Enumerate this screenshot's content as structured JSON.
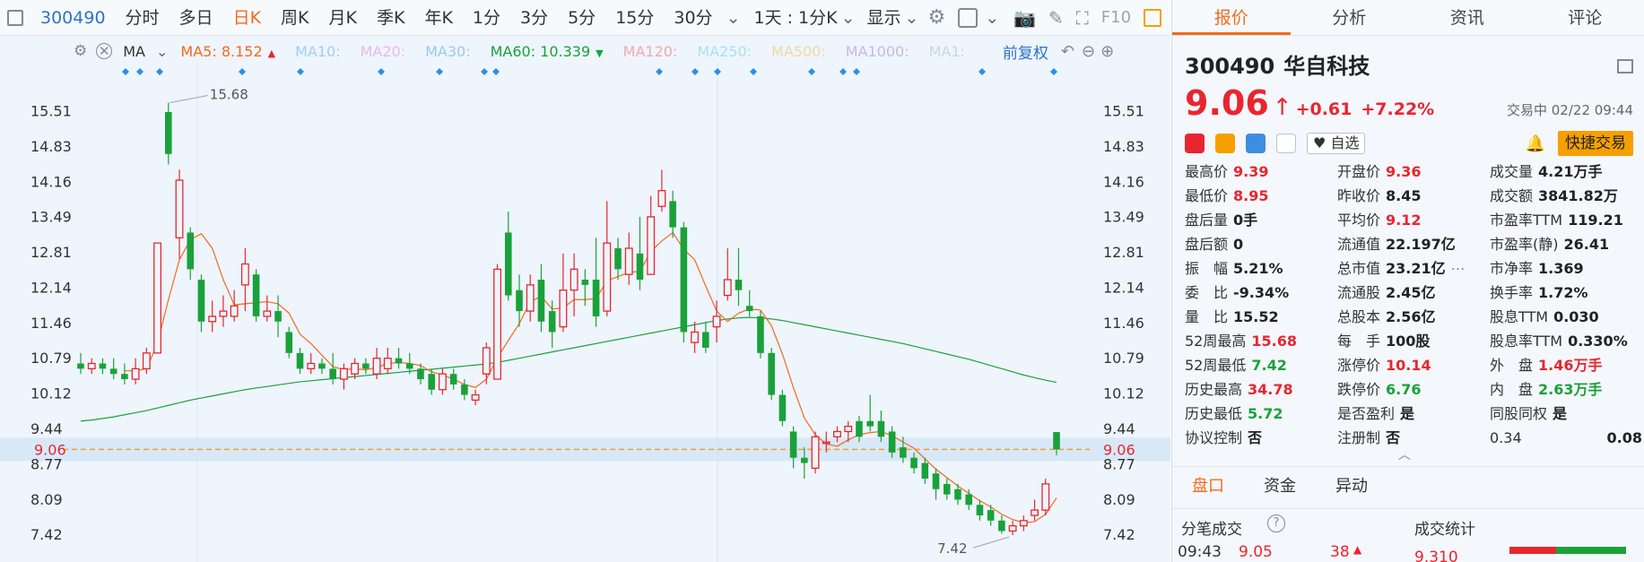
{
  "toolbar": {
    "code": "300490",
    "items": [
      "分时",
      "多日",
      "日K",
      "周K",
      "月K",
      "季K",
      "年K",
      "1分",
      "3分",
      "5分",
      "15分",
      "30分"
    ],
    "active": "日K",
    "interval": "1天 : 1分K",
    "display": "显示",
    "f10": "F10"
  },
  "ma_bar": {
    "label": "MA",
    "items": [
      {
        "text": "MA5: 8.152",
        "color": "#f5691b",
        "marker": "▲"
      },
      {
        "text": "MA10:",
        "color": "#9fd0ef",
        "marker": ""
      },
      {
        "text": "MA20:",
        "color": "#e9b9e6",
        "marker": ""
      },
      {
        "text": "MA30:",
        "color": "#9cc9ef",
        "marker": ""
      },
      {
        "text": "MA60: 10.339",
        "color": "#1aa13a",
        "marker": "▼"
      },
      {
        "text": "MA120:",
        "color": "#f2a8b0",
        "marker": ""
      },
      {
        "text": "MA250:",
        "color": "#a6e3ef",
        "marker": ""
      },
      {
        "text": "MA500:",
        "color": "#f0d9a3",
        "marker": ""
      },
      {
        "text": "MA1000:",
        "color": "#c8b8e8",
        "marker": ""
      },
      {
        "text": "MA1:",
        "color": "#c7d6e8",
        "marker": ""
      }
    ],
    "restore": "前复权"
  },
  "right_tabs": [
    "报价",
    "分析",
    "资讯",
    "评论"
  ],
  "stock": {
    "code": "300490",
    "name": "华自科技",
    "price": "9.06",
    "change": "+0.61",
    "change_pct": "+7.22%",
    "status": "交易中 02/22 09:44",
    "watch_label": "自选",
    "quick_trade": "快捷交易"
  },
  "quote_rows": [
    [
      {
        "label": "最高价",
        "value": "9.39",
        "cls": "red"
      },
      {
        "label": "开盘价",
        "value": "9.36",
        "cls": "red"
      },
      {
        "label": "成交量",
        "value": "4.21万手",
        "cls": "dark"
      }
    ],
    [
      {
        "label": "最低价",
        "value": "8.95",
        "cls": "red"
      },
      {
        "label": "昨收价",
        "value": "8.45",
        "cls": "dark"
      },
      {
        "label": "成交额",
        "value": "3841.82万",
        "cls": "dark"
      }
    ],
    [
      {
        "label": "盘后量",
        "value": "0手",
        "cls": "dark"
      },
      {
        "label": "平均价",
        "value": "9.12",
        "cls": "red"
      },
      {
        "label": "市盈率TTM",
        "value": "119.21",
        "cls": "dark"
      }
    ],
    [
      {
        "label": "盘后额",
        "value": "0",
        "cls": "dark"
      },
      {
        "label": "流通值",
        "value": "22.197亿",
        "cls": "dark"
      },
      {
        "label": "市盈率(静)",
        "value": "26.41",
        "cls": "dark"
      }
    ],
    [
      {
        "label": "振　幅",
        "value": "5.21%",
        "cls": "dark"
      },
      {
        "label": "总市值",
        "value": "23.21亿",
        "cls": "dark"
      },
      {
        "label": "市净率",
        "value": "1.369",
        "cls": "dark"
      }
    ],
    [
      {
        "label": "委　比",
        "value": "-9.34%",
        "cls": "dark"
      },
      {
        "label": "流通股",
        "value": "2.45亿",
        "cls": "dark"
      },
      {
        "label": "换手率",
        "value": "1.72%",
        "cls": "dark"
      }
    ],
    [
      {
        "label": "量　比",
        "value": "15.52",
        "cls": "dark"
      },
      {
        "label": "总股本",
        "value": "2.56亿",
        "cls": "dark"
      },
      {
        "label": "股息TTM",
        "value": "0.030",
        "cls": "dark"
      }
    ],
    [
      {
        "label": "52周最高",
        "value": "15.68",
        "cls": "red"
      },
      {
        "label": "每　手",
        "value": "100股",
        "cls": "dark"
      },
      {
        "label": "股息率TTM",
        "value": "0.330%",
        "cls": "dark"
      }
    ],
    [
      {
        "label": "52周最低",
        "value": "7.42",
        "cls": "green"
      },
      {
        "label": "涨停价",
        "value": "10.14",
        "cls": "red"
      },
      {
        "label": "外　盘",
        "value": "1.46万手",
        "cls": "red"
      }
    ],
    [
      {
        "label": "历史最高",
        "value": "34.78",
        "cls": "red"
      },
      {
        "label": "跌停价",
        "value": "6.76",
        "cls": "green"
      },
      {
        "label": "内　盘",
        "value": "2.63万手",
        "cls": "green"
      }
    ],
    [
      {
        "label": "历史最低",
        "value": "5.72",
        "cls": "green"
      },
      {
        "label": "是否盈利",
        "value": "是",
        "cls": "dark"
      },
      {
        "label": "同股同权",
        "value": "是",
        "cls": "dark"
      }
    ],
    [
      {
        "label": "协议控制",
        "value": "否",
        "cls": "dark"
      },
      {
        "label": "注册制",
        "value": "否",
        "cls": "dark"
      },
      {
        "label": "0.34",
        "value": "0.08",
        "cls": "dark"
      }
    ]
  ],
  "sub_tabs": [
    "盘口",
    "资金",
    "异动"
  ],
  "bottom": {
    "left_title": "分笔成交",
    "right_title": "成交统计",
    "tick_time": "09:43",
    "tick_price": "9.05",
    "tick_vol": "38",
    "stat_value": "9.310"
  },
  "chart_data": {
    "type": "candlestick",
    "y_ticks": [
      15.51,
      14.83,
      14.16,
      13.49,
      12.81,
      12.14,
      11.46,
      10.79,
      10.12,
      9.44,
      8.77,
      8.09,
      7.42
    ],
    "ylim": [
      7.2,
      16.1
    ],
    "current_price": 9.06,
    "high_label": "15.68",
    "low_label": "7.42",
    "up_color": "#e8262f",
    "down_color": "#1aa13a",
    "candles": [
      [
        10.7,
        10.6,
        10.9,
        10.5
      ],
      [
        10.6,
        10.7,
        10.8,
        10.5
      ],
      [
        10.7,
        10.6,
        10.8,
        10.5
      ],
      [
        10.6,
        10.5,
        10.8,
        10.4
      ],
      [
        10.5,
        10.4,
        10.7,
        10.3
      ],
      [
        10.4,
        10.6,
        10.8,
        10.3
      ],
      [
        10.6,
        10.9,
        11.0,
        10.5
      ],
      [
        10.9,
        13.0,
        13.0,
        10.9
      ],
      [
        15.5,
        14.7,
        15.68,
        14.5
      ],
      [
        13.1,
        14.2,
        14.4,
        12.7
      ],
      [
        13.2,
        12.5,
        13.3,
        12.3
      ],
      [
        12.3,
        11.5,
        12.4,
        11.3
      ],
      [
        11.5,
        11.6,
        11.9,
        11.3
      ],
      [
        11.6,
        11.7,
        12.0,
        11.4
      ],
      [
        11.6,
        11.8,
        12.1,
        11.5
      ],
      [
        12.2,
        12.6,
        12.9,
        11.7
      ],
      [
        12.4,
        11.6,
        12.5,
        11.5
      ],
      [
        11.6,
        11.7,
        12.0,
        11.5
      ],
      [
        11.7,
        11.5,
        12.0,
        11.2
      ],
      [
        11.3,
        10.9,
        11.4,
        10.8
      ],
      [
        10.9,
        10.6,
        11.0,
        10.5
      ],
      [
        10.6,
        10.7,
        10.9,
        10.5
      ],
      [
        10.7,
        10.6,
        10.8,
        10.5
      ],
      [
        10.6,
        10.4,
        10.9,
        10.3
      ],
      [
        10.4,
        10.6,
        10.7,
        10.2
      ],
      [
        10.5,
        10.7,
        10.8,
        10.4
      ],
      [
        10.7,
        10.6,
        10.8,
        10.5
      ],
      [
        10.5,
        10.8,
        11.0,
        10.4
      ],
      [
        10.6,
        10.8,
        11.0,
        10.5
      ],
      [
        10.8,
        10.7,
        11.0,
        10.6
      ],
      [
        10.7,
        10.6,
        10.9,
        10.5
      ],
      [
        10.6,
        10.4,
        10.7,
        10.3
      ],
      [
        10.5,
        10.2,
        10.6,
        10.1
      ],
      [
        10.2,
        10.5,
        10.6,
        10.1
      ],
      [
        10.5,
        10.3,
        10.6,
        10.2
      ],
      [
        10.3,
        10.1,
        10.4,
        10.0
      ],
      [
        10.0,
        10.1,
        10.2,
        9.9
      ],
      [
        10.5,
        11.0,
        11.1,
        10.3
      ],
      [
        10.4,
        12.5,
        12.6,
        10.4
      ],
      [
        13.2,
        12.0,
        13.6,
        11.9
      ],
      [
        12.1,
        11.7,
        12.4,
        11.4
      ],
      [
        11.7,
        12.2,
        12.4,
        11.5
      ],
      [
        12.3,
        11.5,
        12.6,
        11.3
      ],
      [
        11.7,
        11.3,
        11.9,
        11.0
      ],
      [
        11.4,
        12.1,
        12.8,
        11.3
      ],
      [
        12.1,
        12.5,
        12.8,
        11.6
      ],
      [
        12.3,
        12.2,
        12.5,
        11.8
      ],
      [
        12.3,
        11.6,
        13.1,
        11.4
      ],
      [
        11.7,
        13.0,
        13.8,
        11.6
      ],
      [
        12.9,
        12.5,
        13.1,
        12.3
      ],
      [
        12.4,
        12.9,
        13.2,
        12.2
      ],
      [
        12.8,
        12.3,
        13.5,
        12.1
      ],
      [
        12.4,
        13.5,
        13.9,
        12.4
      ],
      [
        13.7,
        14.0,
        14.4,
        13.6
      ],
      [
        13.8,
        13.3,
        14.0,
        13.1
      ],
      [
        13.3,
        11.3,
        13.4,
        11.1
      ],
      [
        11.1,
        11.3,
        11.5,
        10.9
      ],
      [
        11.3,
        11.0,
        11.5,
        10.9
      ],
      [
        11.4,
        11.6,
        11.9,
        11.1
      ],
      [
        12.0,
        12.3,
        12.9,
        11.9
      ],
      [
        12.3,
        12.1,
        12.9,
        11.8
      ],
      [
        11.8,
        11.7,
        12.1,
        11.6
      ],
      [
        11.6,
        10.9,
        11.7,
        10.8
      ],
      [
        10.9,
        10.1,
        11.0,
        10.0
      ],
      [
        10.1,
        9.6,
        10.2,
        9.5
      ],
      [
        9.4,
        8.9,
        9.5,
        8.7
      ],
      [
        8.9,
        8.8,
        9.1,
        8.5
      ],
      [
        8.7,
        9.3,
        9.4,
        8.6
      ],
      [
        9.2,
        9.2,
        9.4,
        9.0
      ],
      [
        9.3,
        9.4,
        9.5,
        9.2
      ],
      [
        9.4,
        9.5,
        9.6,
        9.2
      ],
      [
        9.6,
        9.3,
        9.7,
        9.2
      ],
      [
        9.6,
        9.5,
        10.1,
        9.4
      ],
      [
        9.6,
        9.3,
        9.8,
        9.2
      ],
      [
        9.4,
        9.0,
        9.5,
        8.9
      ],
      [
        9.1,
        8.9,
        9.3,
        8.8
      ],
      [
        8.9,
        8.7,
        9.0,
        8.6
      ],
      [
        8.8,
        8.5,
        8.9,
        8.4
      ],
      [
        8.6,
        8.3,
        8.7,
        8.1
      ],
      [
        8.4,
        8.2,
        8.5,
        8.1
      ],
      [
        8.3,
        8.1,
        8.4,
        8.0
      ],
      [
        8.2,
        8.0,
        8.3,
        7.9
      ],
      [
        8.0,
        7.8,
        8.1,
        7.7
      ],
      [
        7.9,
        7.7,
        8.0,
        7.6
      ],
      [
        7.7,
        7.5,
        7.8,
        7.45
      ],
      [
        7.5,
        7.6,
        7.7,
        7.42
      ],
      [
        7.6,
        7.7,
        7.8,
        7.5
      ],
      [
        7.8,
        7.9,
        8.1,
        7.7
      ],
      [
        7.9,
        8.4,
        8.5,
        7.8
      ],
      [
        9.39,
        9.06,
        9.39,
        8.95
      ]
    ],
    "ma5_color": "#f5691b",
    "ma60_color": "#1aa13a",
    "ma60": [
      9.6,
      9.62,
      9.65,
      9.68,
      9.72,
      9.76,
      9.8,
      9.85,
      9.9,
      9.95,
      10.0,
      10.04,
      10.08,
      10.12,
      10.16,
      10.2,
      10.23,
      10.26,
      10.29,
      10.32,
      10.35,
      10.37,
      10.39,
      10.41,
      10.43,
      10.45,
      10.47,
      10.49,
      10.51,
      10.53,
      10.55,
      10.57,
      10.59,
      10.61,
      10.63,
      10.65,
      10.67,
      10.69,
      10.72,
      10.76,
      10.8,
      10.84,
      10.88,
      10.92,
      10.96,
      11.0,
      11.04,
      11.08,
      11.12,
      11.16,
      11.2,
      11.24,
      11.28,
      11.32,
      11.36,
      11.4,
      11.44,
      11.48,
      11.52,
      11.55,
      11.57,
      11.58,
      11.57,
      11.55,
      11.52,
      11.48,
      11.44,
      11.4,
      11.36,
      11.32,
      11.28,
      11.24,
      11.2,
      11.16,
      11.12,
      11.08,
      11.03,
      10.98,
      10.93,
      10.88,
      10.83,
      10.78,
      10.72,
      10.66,
      10.6,
      10.54,
      10.48,
      10.43,
      10.38,
      10.34
    ]
  }
}
